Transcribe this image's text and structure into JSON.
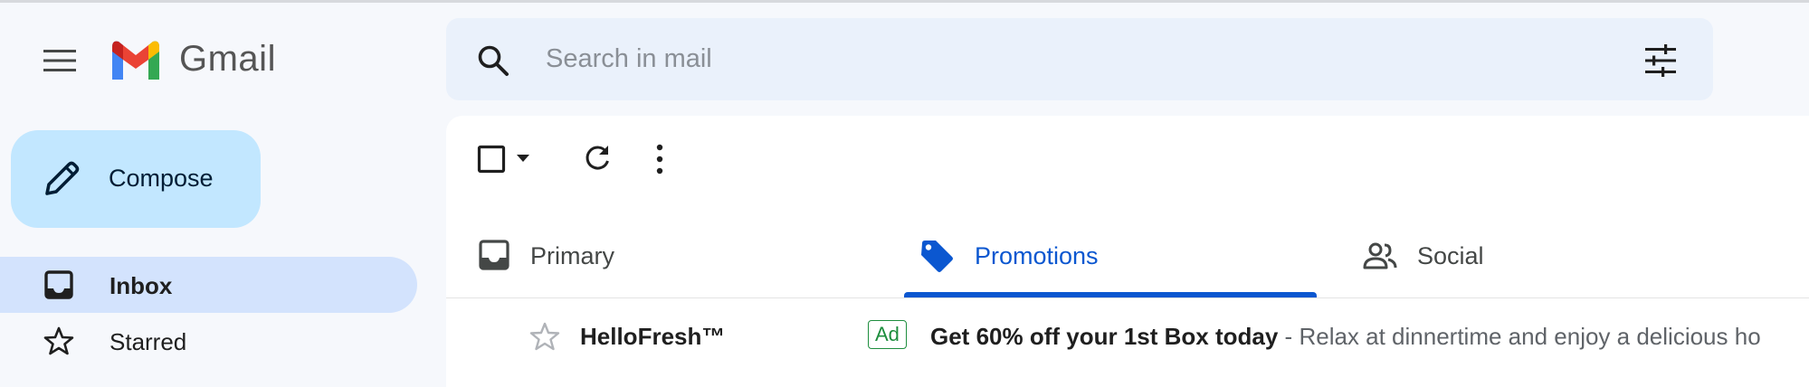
{
  "header": {
    "menu_icon": "hamburger-menu-icon",
    "app_name": "Gmail",
    "logo_colors": [
      "#4285F4",
      "#EA4335",
      "#FBBC04",
      "#34A853",
      "#C5221F"
    ],
    "search": {
      "placeholder": "Search in mail",
      "value": ""
    },
    "search_icon": "search-icon",
    "filter_icon": "tune-icon"
  },
  "sidebar": {
    "compose_label": "Compose",
    "items": [
      {
        "label": "Inbox",
        "icon": "inbox-icon",
        "active": true
      },
      {
        "label": "Starred",
        "icon": "star-outline-icon",
        "active": false
      }
    ]
  },
  "toolbar": {
    "select_icon": "checkbox-icon",
    "select_menu_icon": "caret-down-icon",
    "refresh_icon": "refresh-icon",
    "more_icon": "more-vert-icon"
  },
  "tabs": [
    {
      "label": "Primary",
      "icon": "inbox-tab-icon",
      "active": false
    },
    {
      "label": "Promotions",
      "icon": "tag-icon",
      "active": true
    },
    {
      "label": "Social",
      "icon": "people-icon",
      "active": false
    }
  ],
  "emails": [
    {
      "sender": "HelloFresh™",
      "badge": "Ad",
      "subject": "Get 60% off your 1st Box today",
      "separator": "-",
      "preview": "Relax at dinnertime and enjoy a delicious ho",
      "starred": false
    }
  ],
  "colors": {
    "accent": "#0b57d0",
    "compose_bg": "#c2e7ff",
    "active_nav_bg": "#d3e3fd",
    "search_bg": "#eaf1fb",
    "ad_green": "#1e8e3e"
  }
}
